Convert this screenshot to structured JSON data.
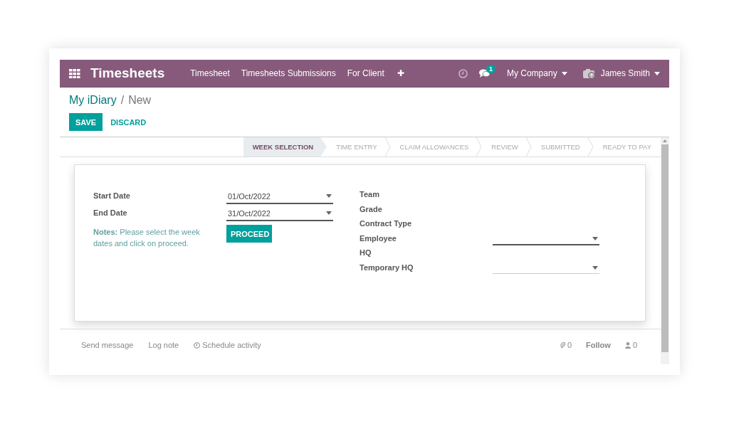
{
  "navbar": {
    "app_title": "Timesheets",
    "menus": [
      "Timesheet",
      "Timesheets Submissions",
      "For Client"
    ],
    "add_icon": "✚",
    "message_count": "1",
    "company": "My Company",
    "user": "James Smith"
  },
  "breadcrumb": {
    "parent": "My iDiary",
    "separator": "/",
    "current": "New"
  },
  "buttons": [
    "SAVE",
    "DISCARD"
  ],
  "stages": [
    {
      "label": "WEEK SELECTION",
      "selected": true
    },
    {
      "label": "TIME ENTRY",
      "selected": false
    },
    {
      "label": "CLAIM ALLOWANCES",
      "selected": false
    },
    {
      "label": "REVIEW",
      "selected": false
    },
    {
      "label": "SUBMITTED",
      "selected": false
    },
    {
      "label": "READY TO PAY",
      "selected": false
    }
  ],
  "form": {
    "left_fields": [
      {
        "label": "Start Date",
        "value": "01/Oct/2022",
        "required": true
      },
      {
        "label": "End Date",
        "value": "31/Oct/2022",
        "required": true
      }
    ],
    "notes": "**Notes:** Please select the week dates and click on proceed.",
    "proceed": "PROCEED",
    "right_fields": [
      {
        "label": "Team",
        "kind": "text"
      },
      {
        "label": "Grade",
        "kind": "text"
      },
      {
        "label": "Contract Type",
        "kind": "text"
      },
      {
        "label": "Employee",
        "kind": "select",
        "required": true
      },
      {
        "label": "HQ",
        "kind": "text"
      },
      {
        "label": "Temporary HQ",
        "kind": "select",
        "required": false
      }
    ]
  },
  "chatter": {
    "actions": [
      "Send message",
      "Log note",
      "Schedule activity"
    ],
    "attachments": "0",
    "follow": "Follow",
    "followers": "0"
  }
}
